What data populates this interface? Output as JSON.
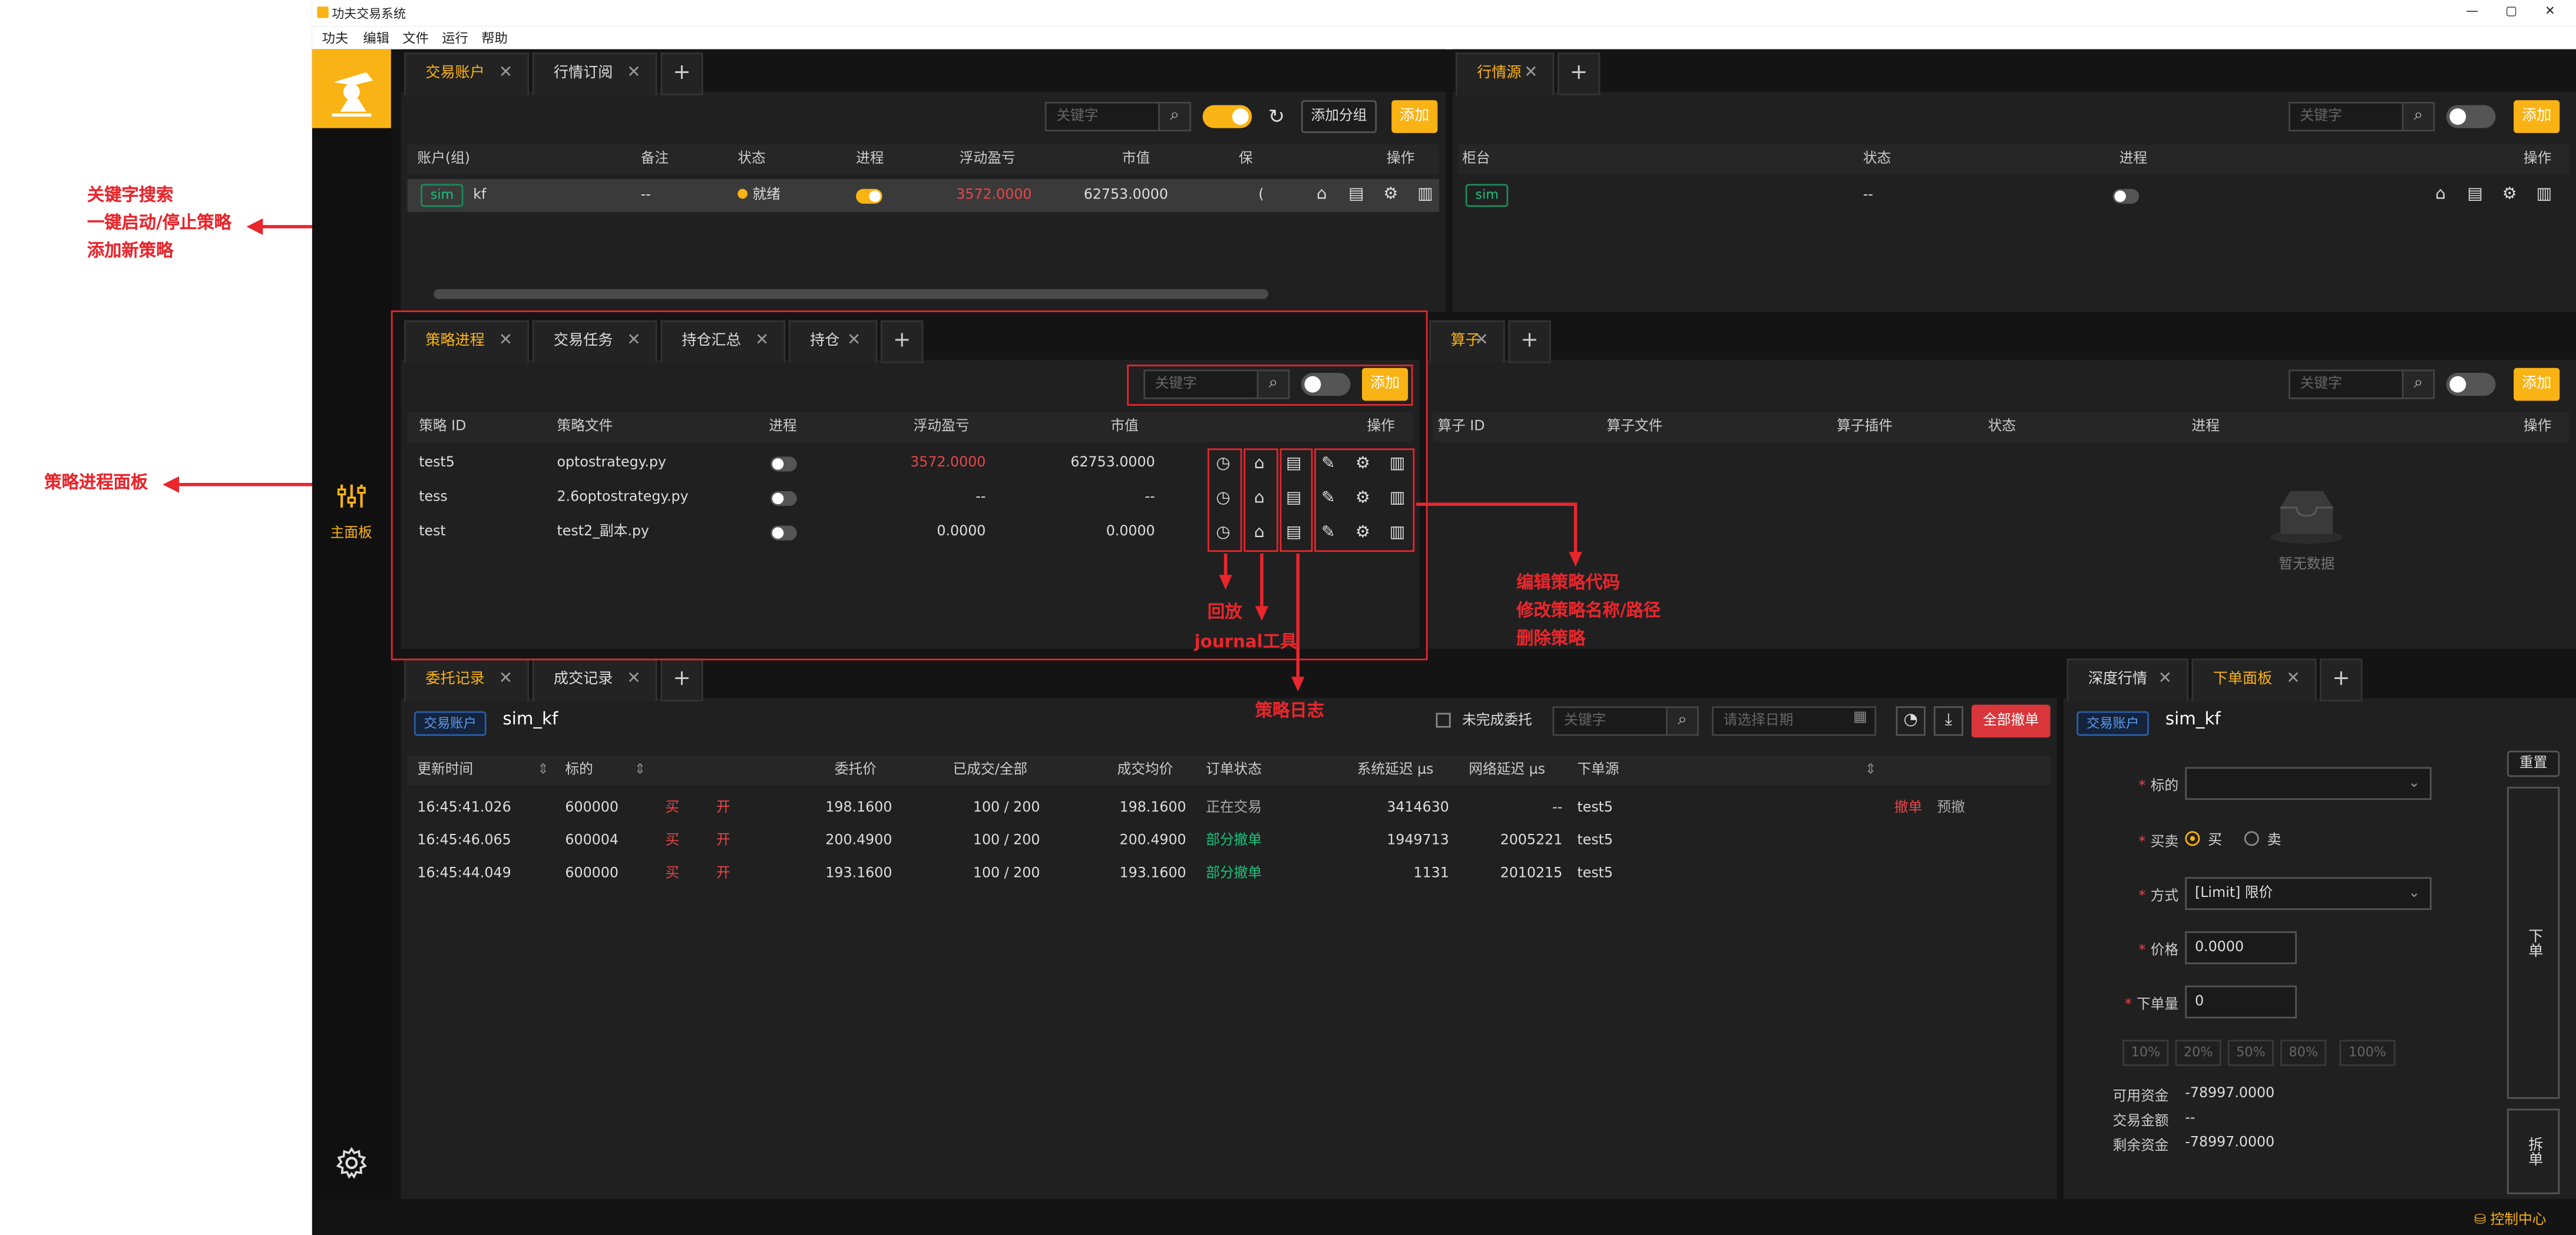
{
  "app": {
    "title": "功夫交易系统",
    "menu": [
      "功夫",
      "编辑",
      "文件",
      "运行",
      "帮助"
    ],
    "window_controls": [
      "—",
      "▢",
      "✕"
    ],
    "footer": "控制中心"
  },
  "sidebar": {
    "active_label": "主面板"
  },
  "annotations": {
    "top_lines": [
      "关键字搜索",
      "一键启动/停止策略",
      "添加新策略"
    ],
    "left_panel": "策略进程面板",
    "replay": "回放",
    "journal": "journal工具",
    "log": "策略日志",
    "right_lines": [
      "编辑策略代码",
      "修改策略名称/路径",
      "删除策略"
    ]
  },
  "accounts_panel": {
    "tabs": [
      "交易账户",
      "行情订阅"
    ],
    "search_placeholder": "关键字",
    "add_group": "添加分组",
    "add": "添加",
    "columns": [
      "账户(组)",
      "备注",
      "状态",
      "进程",
      "浮动盈亏",
      "市值",
      "保",
      "操作"
    ],
    "row": {
      "tag": "sim",
      "name": "kf",
      "note": "--",
      "status": "就绪",
      "pnl": "3572.0000",
      "market_value": "62753.0000",
      "margin": "("
    }
  },
  "md_panel": {
    "tabs": [
      "行情源"
    ],
    "search_placeholder": "关键字",
    "add": "添加",
    "columns": [
      "柜台",
      "状态",
      "进程",
      "操作"
    ],
    "row": {
      "tag": "sim",
      "status": "--"
    }
  },
  "strategy_panel": {
    "tabs": [
      "策略进程",
      "交易任务",
      "持仓汇总",
      "持仓"
    ],
    "search_placeholder": "关键字",
    "add": "添加",
    "columns": [
      "策略 ID",
      "策略文件",
      "进程",
      "浮动盈亏",
      "市值",
      "操作"
    ],
    "rows": [
      {
        "id": "test5",
        "file": "optostrategy.py",
        "on": false,
        "pnl": "3572.0000",
        "pnl_red": true,
        "mv": "62753.0000"
      },
      {
        "id": "tess",
        "file": "2.6optostrategy.py",
        "on": false,
        "pnl": "--",
        "pnl_red": false,
        "mv": "--"
      },
      {
        "id": "test",
        "file": "test2_副本.py",
        "on": false,
        "pnl": "0.0000",
        "pnl_red": false,
        "mv": "0.0000"
      }
    ]
  },
  "algo_panel": {
    "tabs": [
      "算子"
    ],
    "search_placeholder": "关键字",
    "add": "添加",
    "columns": [
      "算子 ID",
      "算子文件",
      "算子插件",
      "状态",
      "进程",
      "操作"
    ],
    "empty": "暂无数据"
  },
  "orders_panel": {
    "tabs": [
      "委托记录",
      "成交记录"
    ],
    "account_tag": "交易账户",
    "account": "sim_kf",
    "unfinished_label": "未完成委托",
    "search_placeholder": "关键字",
    "date_placeholder": "请选择日期",
    "cancel_all": "全部撤单",
    "columns": [
      "更新时间",
      "标的",
      "",
      "",
      "委托价",
      "已成交/全部",
      "成交均价",
      "订单状态",
      "系统延迟 μs",
      "网络延迟 μs",
      "下单源"
    ],
    "rows": [
      {
        "time": "16:45:41.026",
        "symbol": "600000",
        "side": "买",
        "offset": "开",
        "price": "198.1600",
        "filled": "100 / 200",
        "avg": "198.1600",
        "status": "正在交易",
        "status_green": false,
        "sys": "3414630",
        "net": "--",
        "source": "test5",
        "act1": "撤单",
        "act2": "预撤"
      },
      {
        "time": "16:45:46.065",
        "symbol": "600004",
        "side": "买",
        "offset": "开",
        "price": "200.4900",
        "filled": "100 / 200",
        "avg": "200.4900",
        "status": "部分撤单",
        "status_green": true,
        "sys": "1949713",
        "net": "2005221",
        "source": "test5",
        "act1": "",
        "act2": ""
      },
      {
        "time": "16:45:44.049",
        "symbol": "600000",
        "side": "买",
        "offset": "开",
        "price": "193.1600",
        "filled": "100 / 200",
        "avg": "193.1600",
        "status": "部分撤单",
        "status_green": true,
        "sys": "1131",
        "net": "2010215",
        "source": "test5",
        "act1": "",
        "act2": ""
      }
    ]
  },
  "order_form": {
    "tabs": [
      "深度行情",
      "下单面板"
    ],
    "account_tag": "交易账户",
    "account": "sim_kf",
    "reset": "重置",
    "labels": {
      "symbol": "标的",
      "side": "买卖",
      "method": "方式",
      "price": "价格",
      "qty": "下单量"
    },
    "side_buy": "买",
    "side_sell": "卖",
    "method_value": "[Limit] 限价",
    "price_value": "0.0000",
    "qty_value": "0",
    "percents": [
      "10%",
      "20%",
      "50%",
      "80%",
      "100%"
    ],
    "available_label": "可用资金",
    "available_value": "-78997.0000",
    "trade_amount_label": "交易金额",
    "trade_amount_value": "--",
    "remaining_label": "剩余资金",
    "remaining_value": "-78997.0000",
    "place_order": "下单",
    "split_order": "拆单"
  }
}
